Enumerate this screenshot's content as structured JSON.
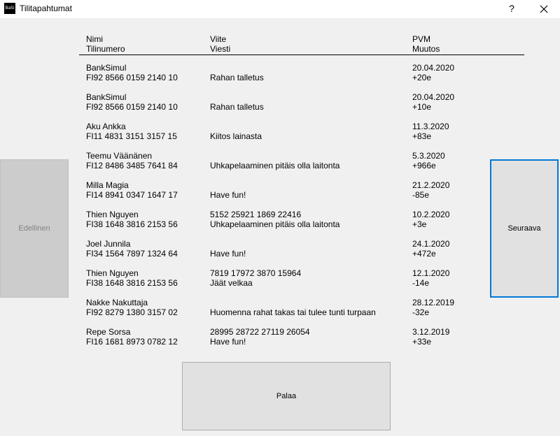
{
  "window": {
    "icon_text": "BaSi",
    "title": "Tilitapahtumat",
    "help_label": "?"
  },
  "header": {
    "col1_line1": "Nimi",
    "col1_line2": "Tilinumero",
    "col2_line1": "Viite",
    "col2_line2": "Viesti",
    "col3_line1": "PVM",
    "col3_line2": "Muutos"
  },
  "transactions": [
    {
      "name": "BankSimul",
      "account": "FI92 8566 0159 2140 10",
      "reference": "",
      "message": "Rahan talletus",
      "date": "20.04.2020",
      "change": "+20e"
    },
    {
      "name": "BankSimul",
      "account": "FI92 8566 0159 2140 10",
      "reference": "",
      "message": "Rahan talletus",
      "date": "20.04.2020",
      "change": "+10e"
    },
    {
      "name": "Aku Ankka",
      "account": "FI11 4831 3151 3157 15",
      "reference": "",
      "message": "Kiitos lainasta",
      "date": "11.3.2020",
      "change": "+83e"
    },
    {
      "name": "Teemu Väänänen",
      "account": "FI12 8486 3485 7641 84",
      "reference": "",
      "message": "Uhkapelaaminen pitäis olla laitonta",
      "date": "5.3.2020",
      "change": "+966e"
    },
    {
      "name": "Milla Magia",
      "account": "FI14 8941 0347 1647 17",
      "reference": "",
      "message": "Have fun!",
      "date": "21.2.2020",
      "change": "-85e"
    },
    {
      "name": "Thien Nguyen",
      "account": "FI38 1648 3816 2153 56",
      "reference": "5152 25921 1869 22416",
      "message": "Uhkapelaaminen pitäis olla laitonta",
      "date": "10.2.2020",
      "change": "+3e"
    },
    {
      "name": "Joel Junnila",
      "account": "FI34 1564 7897 1324 64",
      "reference": "",
      "message": "Have fun!",
      "date": "24.1.2020",
      "change": "+472e"
    },
    {
      "name": "Thien Nguyen",
      "account": "FI38 1648 3816 2153 56",
      "reference": "7819 17972 3870 15964",
      "message": "Jäät velkaa",
      "date": "12.1.2020",
      "change": "-14e"
    },
    {
      "name": "Nakke Nakuttaja",
      "account": "FI92 8279 1380 3157 02",
      "reference": "",
      "message": "Huomenna rahat takas tai tulee tunti turpaan",
      "date": "28.12.2019",
      "change": "-32e"
    },
    {
      "name": "Repe Sorsa",
      "account": "FI16 1681 8973 0782 12",
      "reference": "28995 28722 27119 26054",
      "message": "Have fun!",
      "date": "3.12.2019",
      "change": "+33e"
    }
  ],
  "buttons": {
    "previous": "Edellinen",
    "next": "Seuraava",
    "back": "Palaa"
  },
  "colors": {
    "focus_border": "#0078d7",
    "disabled_button": "#cccccc",
    "button_face": "#e1e1e1"
  }
}
